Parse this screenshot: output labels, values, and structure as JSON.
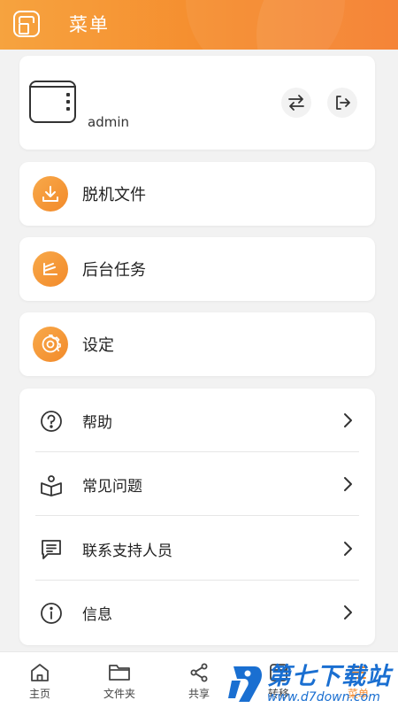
{
  "header": {
    "title": "菜单"
  },
  "account": {
    "username": "admin"
  },
  "features": [
    {
      "label": "脱机文件",
      "icon": "download-icon"
    },
    {
      "label": "后台任务",
      "icon": "stack-icon"
    },
    {
      "label": "设定",
      "icon": "gear-icon"
    }
  ],
  "help_items": [
    {
      "label": "帮助",
      "icon": "question-icon"
    },
    {
      "label": "常见问题",
      "icon": "book-person-icon"
    },
    {
      "label": "联系支持人员",
      "icon": "chat-icon"
    },
    {
      "label": "信息",
      "icon": "info-icon"
    }
  ],
  "tabs": [
    {
      "label": "主页",
      "icon": "home-icon"
    },
    {
      "label": "文件夹",
      "icon": "folder-icon"
    },
    {
      "label": "共享",
      "icon": "share-icon"
    },
    {
      "label": "转移",
      "icon": "transfer-icon"
    },
    {
      "label": "菜单",
      "icon": "menu-icon"
    }
  ],
  "watermark": {
    "name": "第七下载站",
    "url": "www.d7down.com"
  },
  "colors": {
    "accent": "#f58a2c",
    "watermark": "#1a6fd1"
  }
}
